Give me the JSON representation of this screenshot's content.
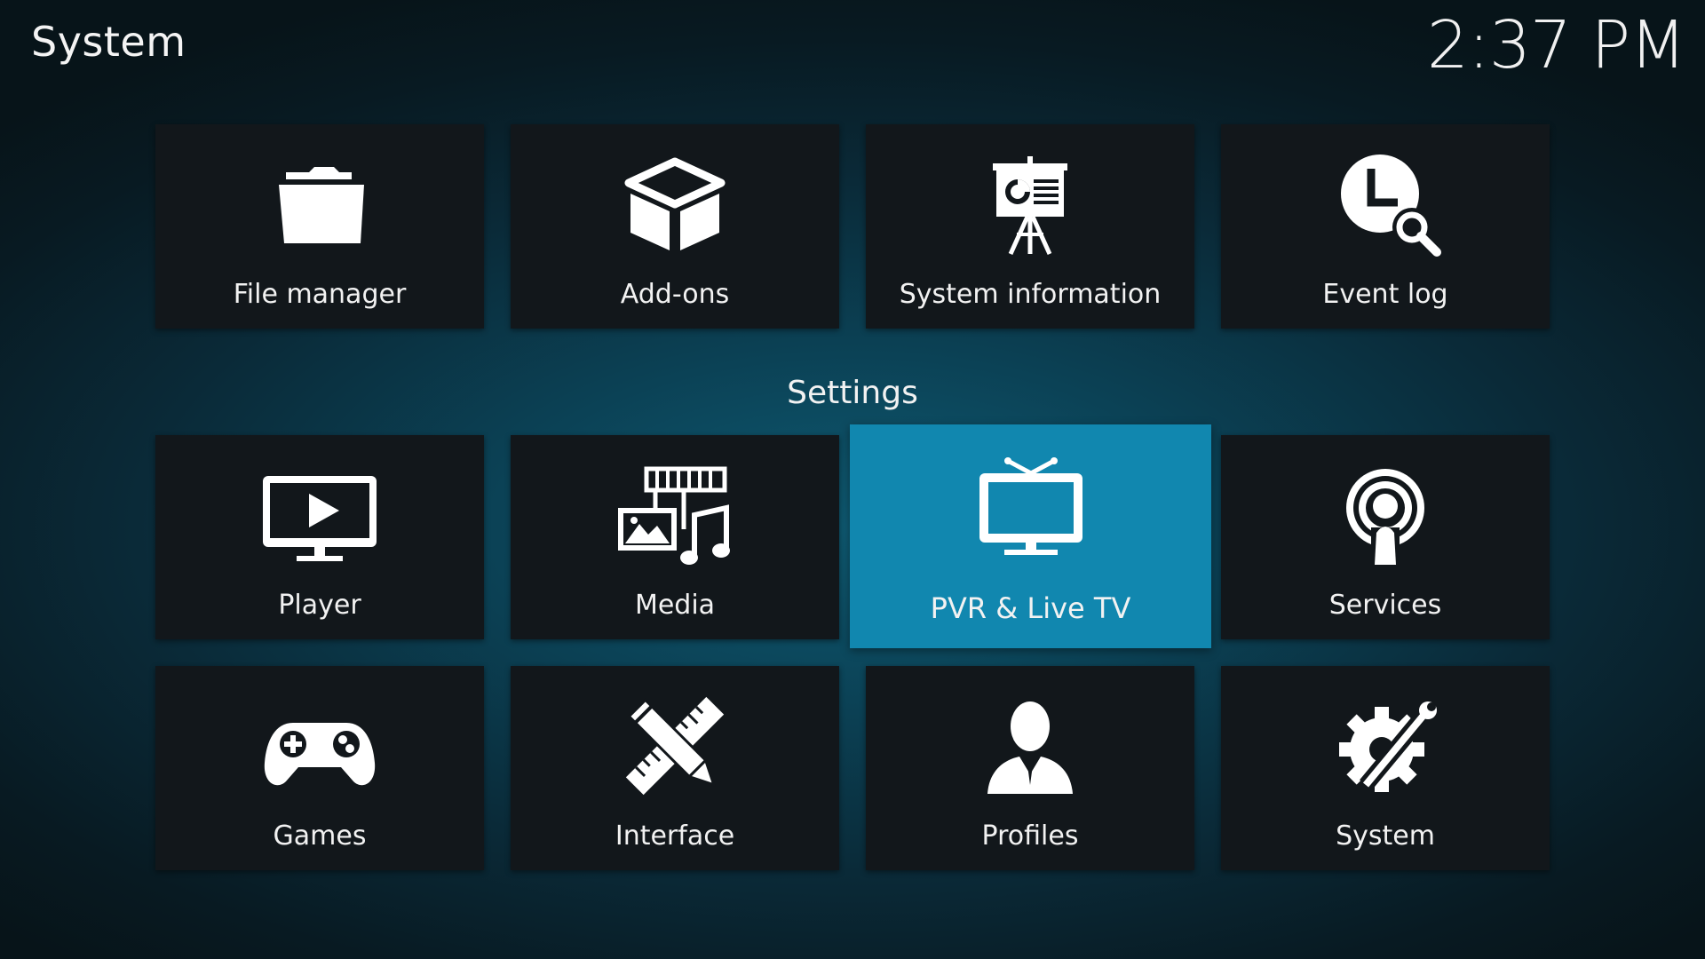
{
  "header": {
    "title": "System",
    "clock": "2:37 PM"
  },
  "top_tiles": [
    {
      "label": "File manager",
      "icon": "folder-icon"
    },
    {
      "label": "Add-ons",
      "icon": "box-icon"
    },
    {
      "label": "System information",
      "icon": "presentation-icon"
    },
    {
      "label": "Event log",
      "icon": "clock-search-icon"
    }
  ],
  "settings": {
    "heading": "Settings",
    "row1": [
      {
        "label": "Player",
        "icon": "monitor-play-icon"
      },
      {
        "label": "Media",
        "icon": "media-icon"
      },
      {
        "label": "PVR & Live TV",
        "icon": "tv-icon",
        "focused": true
      },
      {
        "label": "Services",
        "icon": "broadcast-icon"
      }
    ],
    "row2": [
      {
        "label": "Games",
        "icon": "gamepad-icon"
      },
      {
        "label": "Interface",
        "icon": "pencil-ruler-icon"
      },
      {
        "label": "Profiles",
        "icon": "user-icon"
      },
      {
        "label": "System",
        "icon": "gear-wrench-icon"
      }
    ]
  },
  "colors": {
    "tile_bg": "#12171b",
    "focus_bg": "#1187af",
    "text": "#f2f2f2"
  }
}
